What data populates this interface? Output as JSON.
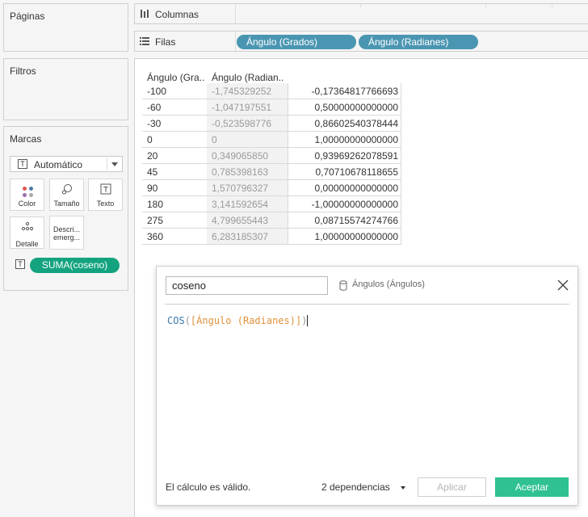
{
  "left_panel": {
    "pages_title": "Páginas",
    "filters_title": "Filtros",
    "marks_title": "Marcas",
    "mark_type": "Automático",
    "mark_buttons": {
      "color": "Color",
      "size": "Tamaño",
      "text": "Texto",
      "detail": "Detalle",
      "tooltip": "Descri... emerg..."
    },
    "coseno_pill": "SUMA(coseno)"
  },
  "shelves": {
    "columns_label": "Columnas",
    "rows_label": "Filas",
    "row_pills": [
      "Ángulo (Grados)",
      "Ángulo (Radianes)"
    ]
  },
  "table": {
    "headers": [
      "Ángulo (Gra..",
      "Ángulo (Radian.."
    ],
    "rows": [
      [
        "-100",
        "-1,745329252",
        "-0,17364817766693"
      ],
      [
        "-60",
        "-1,047197551",
        "0,50000000000000"
      ],
      [
        "-30",
        "-0,523598776",
        "0,86602540378444"
      ],
      [
        "0",
        "0",
        "1,00000000000000"
      ],
      [
        "20",
        "0,349065850",
        "0,93969262078591"
      ],
      [
        "45",
        "0,785398163",
        "0,70710678118655"
      ],
      [
        "90",
        "1,570796327",
        "0,00000000000000"
      ],
      [
        "180",
        "3,141592654",
        "-1,00000000000000"
      ],
      [
        "275",
        "4,799655443",
        "0,08715574274766"
      ],
      [
        "360",
        "6,283185307",
        "1,00000000000000"
      ]
    ]
  },
  "calc_dialog": {
    "name_value": "coseno",
    "datasource": "Ángulos (Ángulos)",
    "formula_fn": "COS",
    "formula_open": "(",
    "formula_field": "[Ángulo (Radianes)]",
    "formula_close": ")",
    "status": "El cálculo es válido.",
    "dependencies": "2 dependencias",
    "apply_label": "Aplicar",
    "ok_label": "Aceptar"
  },
  "colors": {
    "pill_blue": "#4a96b2",
    "pill_green": "#14a37f",
    "accept_green": "#2fc193"
  }
}
